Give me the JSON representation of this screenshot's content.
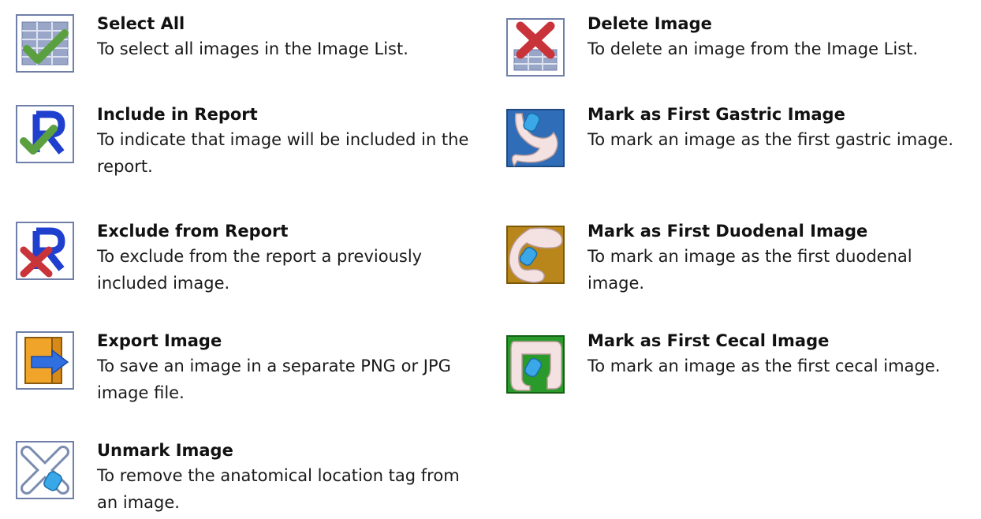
{
  "colors": {
    "frame": "#6f7fa8",
    "check_green": "#5aa040",
    "x_red": "#c8343a",
    "r_blue": "#1f3fcf",
    "folder_orange": "#f0a42a",
    "arrow_blue": "#2f6fe0",
    "gastric_bg": "#2f6db8",
    "duodenal_bg": "#b8861a",
    "cecal_bg": "#2a9a2a"
  },
  "items": {
    "select_all": {
      "icon": "select-all-icon",
      "title": "Select All",
      "desc": "To select all images in the Image List."
    },
    "delete_image": {
      "icon": "delete-image-icon",
      "title": "Delete Image",
      "desc": "To delete an image from the Image List."
    },
    "include_report": {
      "icon": "include-in-report-icon",
      "title": "Include in Report",
      "desc": "To indicate that image will be included in the report."
    },
    "first_gastric": {
      "icon": "first-gastric-icon",
      "title": "Mark as First Gastric Image",
      "desc": "To mark an image as the first gastric image."
    },
    "exclude_report": {
      "icon": "exclude-from-report-icon",
      "title": "Exclude from Report",
      "desc": "To exclude from the report a previously included image."
    },
    "first_duodenal": {
      "icon": "first-duodenal-icon",
      "title": "Mark as First Duodenal Image",
      "desc": "To mark an image as the first duodenal image."
    },
    "export_image": {
      "icon": "export-image-icon",
      "title": "Export Image",
      "desc": "To save an image in a separate PNG or JPG image file."
    },
    "first_cecal": {
      "icon": "first-cecal-icon",
      "title": "Mark as First Cecal Image",
      "desc": "To mark an image as the first cecal image."
    },
    "unmark_image": {
      "icon": "unmark-image-icon",
      "title": "Unmark Image",
      "desc": "To remove the anatomical location tag from an image."
    }
  }
}
